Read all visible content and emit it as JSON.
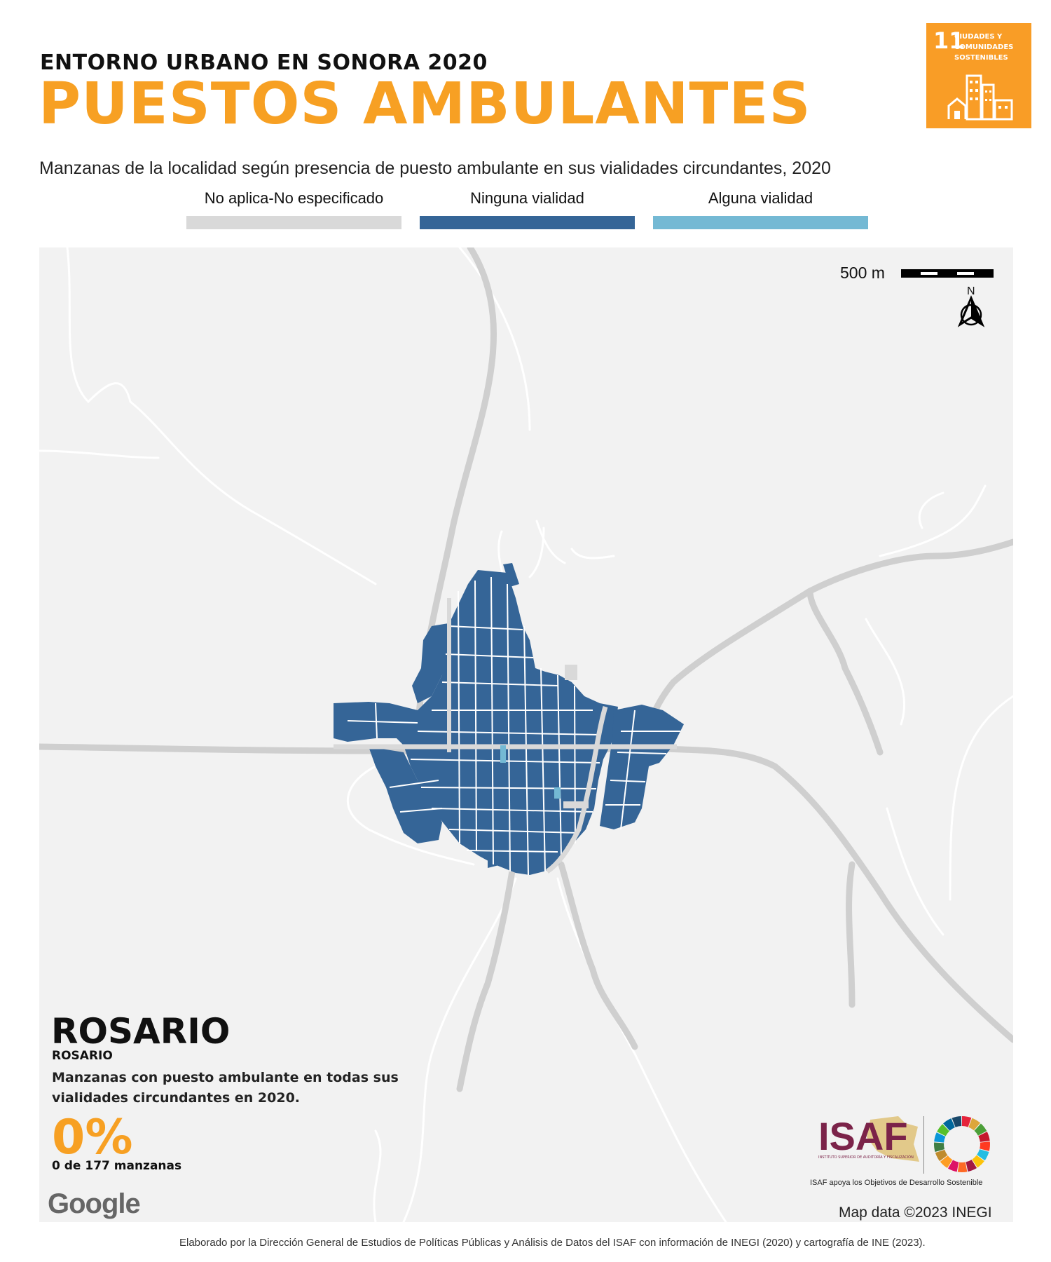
{
  "header": {
    "supertitle": "ENTORNO URBANO EN SONORA 2020",
    "title": "PUESTOS AMBULANTES",
    "subtitle": "Manzanas de la localidad según presencia de puesto ambulante en sus vialidades circundantes, 2020"
  },
  "legend": [
    {
      "label": "No aplica-No especificado",
      "color": "#d9d9d9"
    },
    {
      "label": "Ninguna vialidad",
      "color": "#356597"
    },
    {
      "label": "Alguna vialidad",
      "color": "#74b9d4"
    }
  ],
  "sdg_badge": {
    "number": "11",
    "text_lines": [
      "CIUDADES Y",
      "COMUNIDADES",
      "SOSTENIBLES"
    ],
    "color": "#f99d26"
  },
  "map": {
    "scale_label": "500 m",
    "north_label": "N",
    "background_color": "#f2f2f2",
    "block_color": "#356597",
    "highlight_color": "#74b9d4",
    "na_color": "#d9d9d9"
  },
  "locality": {
    "municipality": "ROSARIO",
    "locality": "ROSARIO",
    "stat_description": "Manzanas con puesto ambulante en todas sus vialidades circundantes en 2020.",
    "percentage": "0%",
    "count_text": "0 de 177 manzanas"
  },
  "attribution": {
    "google": "Google",
    "map_data": "Map data ©2023 INEGI"
  },
  "logos": {
    "isaf": "ISAF",
    "isaf_small": "INSTITUTO SUPERIOR DE AUDITORÍA Y FISCALIZACIÓN",
    "isaf_caption": "ISAF apoya los Objetivos de Desarrollo Sostenible",
    "isaf_color": "#7b2349"
  },
  "footer": "Elaborado por la Dirección General de Estudios de Políticas Públicas y Análisis de Datos del ISAF con información de INEGI (2020) y cartografía de INE (2023)."
}
